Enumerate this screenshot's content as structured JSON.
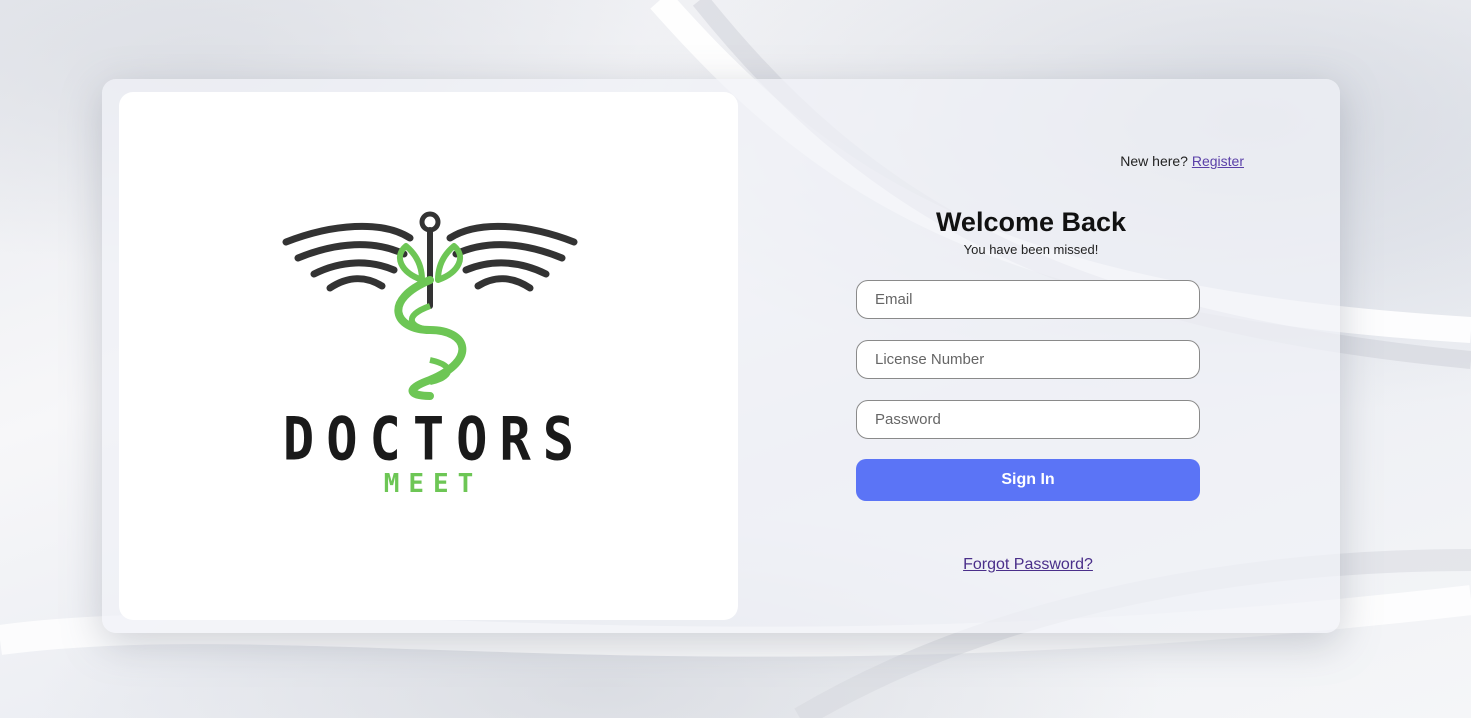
{
  "brand": {
    "logo_word_primary": "DOCTORS",
    "logo_word_secondary": "MEET",
    "colors": {
      "logo_dark": "#333333",
      "logo_green": "#6dc655"
    }
  },
  "header": {
    "prompt_text": "New here?",
    "register_link": "Register"
  },
  "login": {
    "title": "Welcome Back",
    "subtitle": "You have been missed!",
    "fields": {
      "email": {
        "placeholder": "Email",
        "value": ""
      },
      "license": {
        "placeholder": "License Number",
        "value": ""
      },
      "password": {
        "placeholder": "Password",
        "value": ""
      }
    },
    "submit_label": "Sign In",
    "forgot_link": "Forgot Password?"
  },
  "colors": {
    "primary_button": "#5b74f6",
    "link": "#5a3fa8"
  }
}
